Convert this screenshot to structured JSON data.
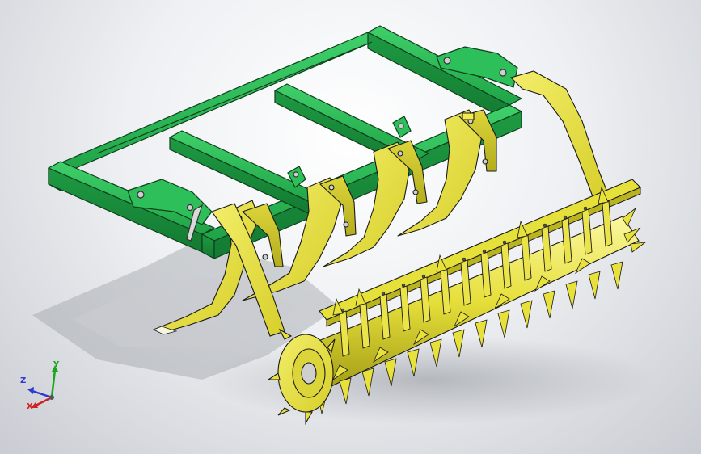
{
  "viewport": {
    "background": "#e4e6ea",
    "frame_color": "#22b14c",
    "part_color": "#e6e13a",
    "edge_color": "#1a1a1a"
  },
  "model": {
    "frame_name": "frame",
    "parts": [
      "frame",
      "shank",
      "roller",
      "hitch-bracket"
    ]
  },
  "triad": {
    "x_label": "X",
    "y_label": "Y",
    "z_label": "Z",
    "x_color": "#d22020",
    "y_color": "#1aa61a",
    "z_color": "#2b3bd1"
  }
}
